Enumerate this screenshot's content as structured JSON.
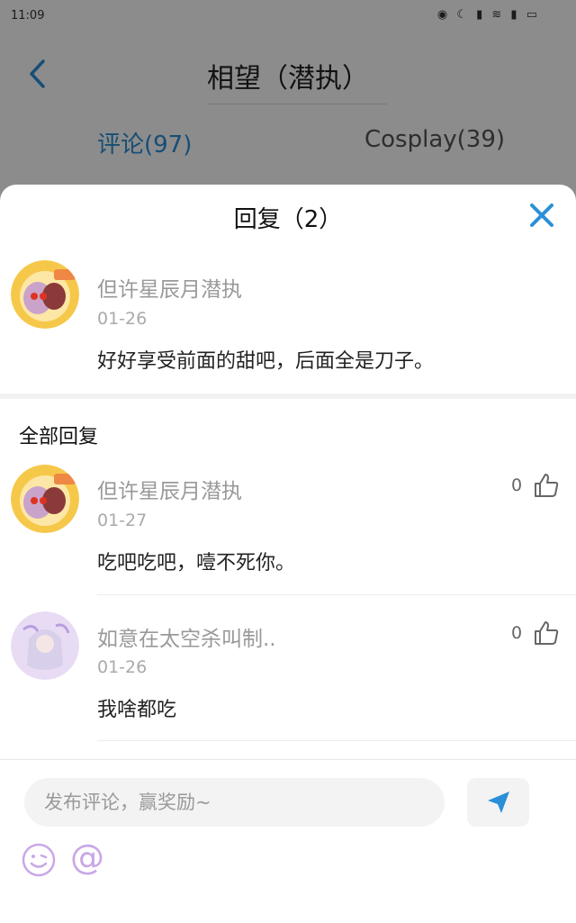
{
  "status_bar": {
    "time": "11:09",
    "icons": "◉ ☾ ▮ ≋ ▮ ▭"
  },
  "page": {
    "title": "相望（潜执）",
    "tabs": [
      {
        "label": "评论(97)",
        "active": true
      },
      {
        "label": "Cosplay(39)",
        "active": false
      }
    ]
  },
  "sheet": {
    "title": "回复（2）",
    "original": {
      "author": "但许星辰月潜执",
      "date": "01-26",
      "text": "好好享受前面的甜吧，后面全是刀子。"
    },
    "section_label": "全部回复",
    "replies": [
      {
        "author": "但许星辰月潜执",
        "date": "01-27",
        "text": "吃吧吃吧，噎不死你。",
        "likes": "0"
      },
      {
        "author": "如意在太空杀叫制..",
        "date": "01-26",
        "text": "我啥都吃",
        "likes": "0"
      }
    ]
  },
  "composer": {
    "placeholder": "发布评论，赢奖励~",
    "at_symbol": "@"
  },
  "colors": {
    "accent": "#2a8fd8",
    "emoji": "#c9a7e6"
  }
}
